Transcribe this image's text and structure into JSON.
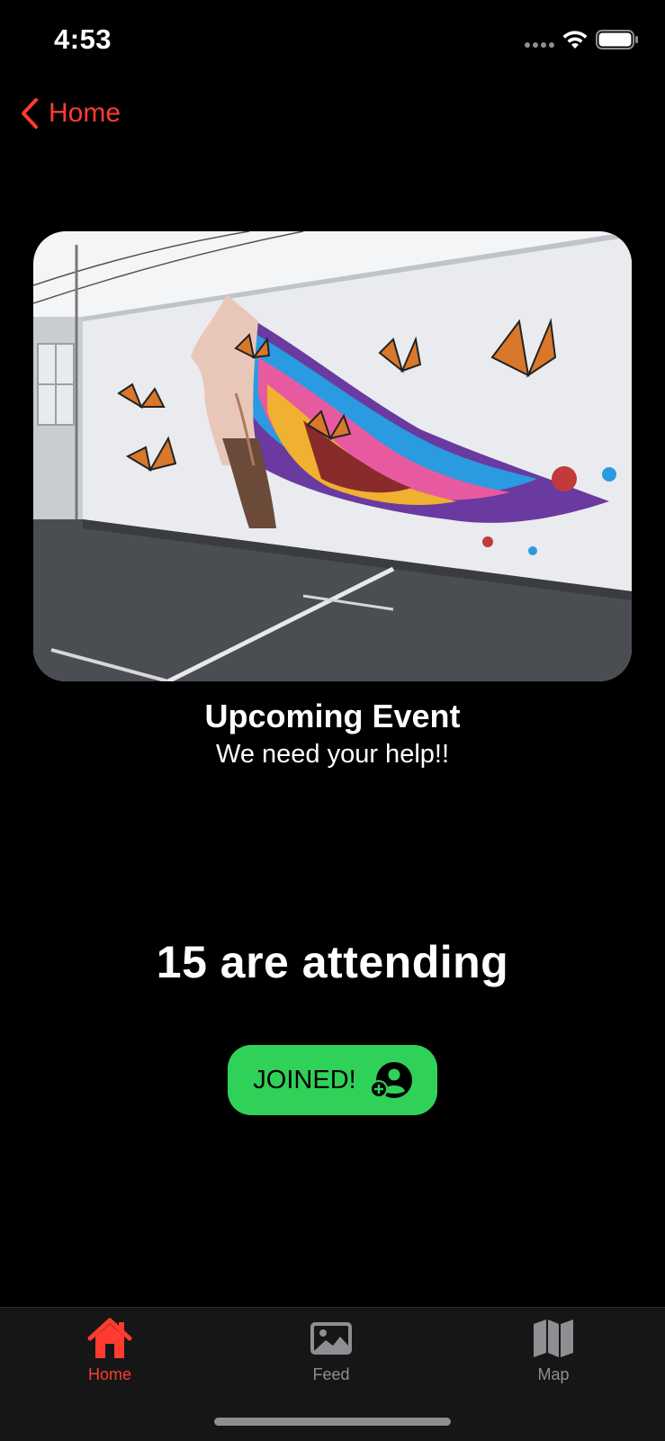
{
  "status_bar": {
    "time": "4:53",
    "icons": [
      "cellular-signal-icon",
      "wifi-icon",
      "battery-icon"
    ]
  },
  "nav": {
    "back_label": "Home",
    "back_icon": "chevron-left-icon"
  },
  "event": {
    "title": "Upcoming Event",
    "subtitle": "We need your help!!",
    "attending_text": "15 are attending",
    "join_label": "JOINED!",
    "join_icon": "person-add-icon"
  },
  "tab_bar": {
    "tabs": [
      {
        "label": "Home",
        "icon": "house-icon",
        "active": true
      },
      {
        "label": "Feed",
        "icon": "photo-icon",
        "active": false
      },
      {
        "label": "Map",
        "icon": "map-icon",
        "active": false
      }
    ]
  },
  "colors": {
    "accent": "#ff3b30",
    "join_button": "#30d158",
    "background": "#000000",
    "tab_bar": "#161616",
    "inactive": "#8e8e93"
  }
}
